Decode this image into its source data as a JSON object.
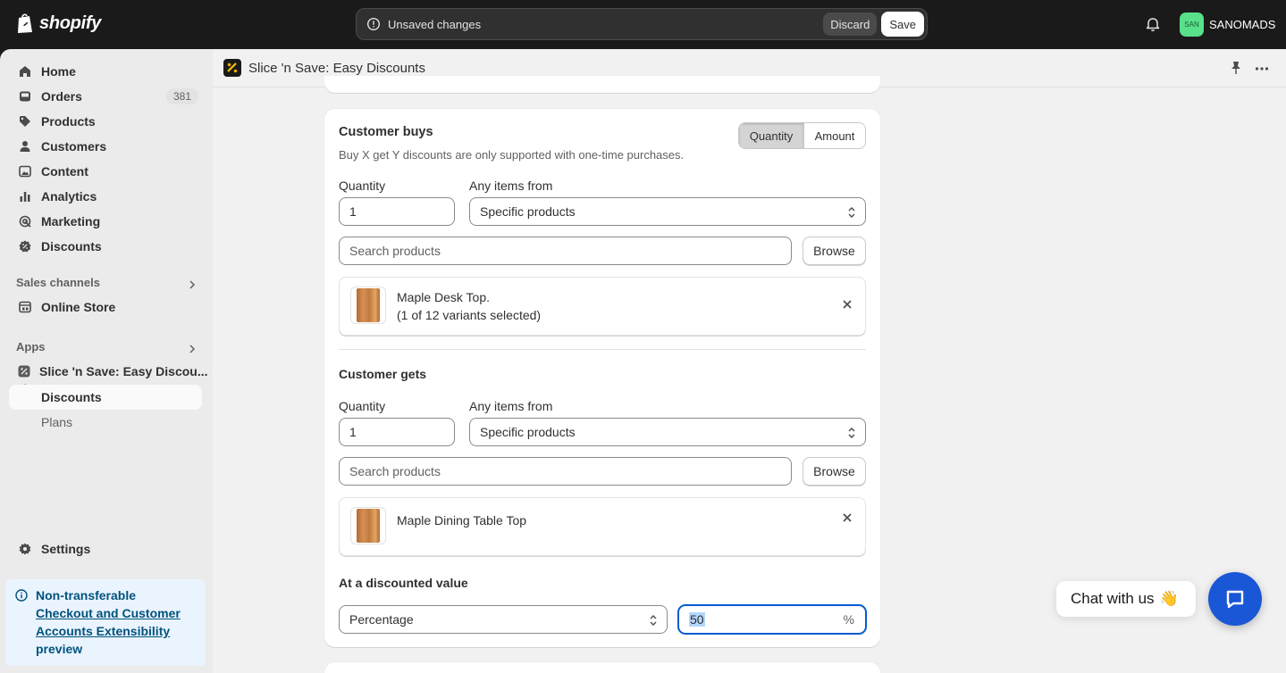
{
  "topbar": {
    "logo_text": "shopify",
    "unsaved_message": "Unsaved changes",
    "discard_label": "Discard",
    "save_label": "Save",
    "avatar_initials": "SAN",
    "account_name": "SANOMADS"
  },
  "sidebar": {
    "items": [
      {
        "label": "Home",
        "icon": "home-icon"
      },
      {
        "label": "Orders",
        "icon": "inbox-icon",
        "count": "381"
      },
      {
        "label": "Products",
        "icon": "tag-icon"
      },
      {
        "label": "Customers",
        "icon": "person-icon"
      },
      {
        "label": "Content",
        "icon": "image-icon"
      },
      {
        "label": "Analytics",
        "icon": "bar-chart-icon"
      },
      {
        "label": "Marketing",
        "icon": "target-icon"
      },
      {
        "label": "Discounts",
        "icon": "discount-icon"
      }
    ],
    "sales_channels_label": "Sales channels",
    "online_store_label": "Online Store",
    "apps_label": "Apps",
    "app_item_label": "Slice 'n Save: Easy Discou...",
    "app_sub_discounts": "Discounts",
    "app_sub_plans": "Plans",
    "settings_label": "Settings",
    "notice": {
      "title": "Non-transferable",
      "link": "Checkout and Customer Accounts Extensibility",
      "tail": "preview"
    }
  },
  "main": {
    "app_title": "Slice 'n Save: Easy Discounts",
    "customer_buys": {
      "title": "Customer buys",
      "toggle_quantity": "Quantity",
      "toggle_amount": "Amount",
      "subtitle": "Buy X get Y discounts are only supported with one-time purchases.",
      "quantity_label": "Quantity",
      "quantity_value": "1",
      "items_from_label": "Any items from",
      "items_from_value": "Specific products",
      "search_placeholder": "Search products",
      "browse_label": "Browse",
      "product_name": "Maple Desk Top.",
      "product_variants": "(1 of 12 variants selected)"
    },
    "customer_gets": {
      "title": "Customer gets",
      "quantity_label": "Quantity",
      "quantity_value": "1",
      "items_from_label": "Any items from",
      "items_from_value": "Specific products",
      "search_placeholder": "Search products",
      "browse_label": "Browse",
      "product_name": "Maple Dining Table Top"
    },
    "discounted_value": {
      "title": "At a discounted value",
      "type_value": "Percentage",
      "amount_value": "50",
      "suffix": "%"
    }
  },
  "chat": {
    "bubble_text": "Chat with us",
    "emoji": "👋"
  },
  "colors": {
    "focus": "#005bd3",
    "chat_button": "#1a57d6",
    "notice_bg": "#eaf4ff",
    "notice_text": "#00527c"
  }
}
